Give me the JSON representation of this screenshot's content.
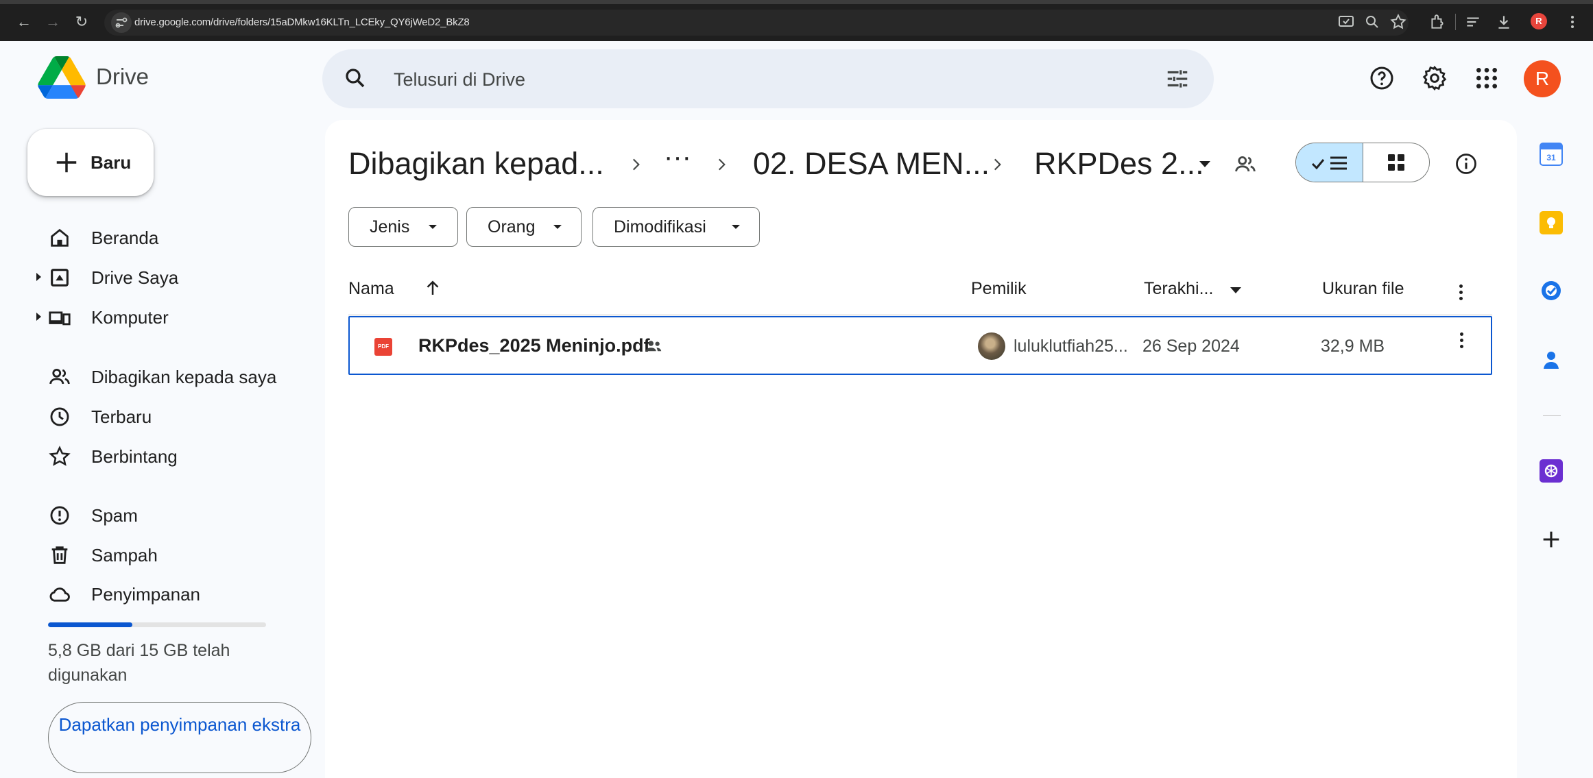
{
  "browser": {
    "url": "drive.google.com/drive/folders/15aDMkw16KLTn_LCEky_QY6jWeD2_BkZ8",
    "profile_initial": "R"
  },
  "app": {
    "product_name": "Drive",
    "account_initial": "R",
    "colors": {
      "accent": "#0b57d0",
      "selected": "#c2e7ff",
      "search_bg": "#e9eef6",
      "avatar": "#f4511e"
    }
  },
  "search": {
    "placeholder": "Telusuri di Drive"
  },
  "sidebar": {
    "new_label": "Baru",
    "items": [
      {
        "label": "Beranda",
        "icon": "home-icon"
      },
      {
        "label": "Drive Saya",
        "icon": "my-drive-icon"
      },
      {
        "label": "Komputer",
        "icon": "computer-icon"
      },
      {
        "label": "Dibagikan kepada saya",
        "icon": "people-icon"
      },
      {
        "label": "Terbaru",
        "icon": "clock-icon"
      },
      {
        "label": "Berbintang",
        "icon": "star-icon"
      },
      {
        "label": "Spam",
        "icon": "spam-icon"
      },
      {
        "label": "Sampah",
        "icon": "trash-icon"
      },
      {
        "label": "Penyimpanan",
        "icon": "cloud-icon"
      }
    ],
    "storage": {
      "text": "5,8 GB dari 15 GB telah digunakan",
      "used_fraction": 0.387
    },
    "get_storage_label": "Dapatkan penyimpanan ekstra"
  },
  "breadcrumb": {
    "root": "Dibagikan kepad...",
    "ellipsis": "···",
    "parent": "02. DESA MEN...",
    "current": "RKPDes 2..."
  },
  "filters": [
    {
      "label": "Jenis"
    },
    {
      "label": "Orang"
    },
    {
      "label": "Dimodifikasi"
    }
  ],
  "table": {
    "columns": {
      "name": "Nama",
      "owner": "Pemilik",
      "modified": "Terakhi...",
      "size": "Ukuran file"
    },
    "rows": [
      {
        "name": "RKPdes_2025 Meninjo.pdf",
        "type_badge": "PDF",
        "owner": "luluklutfiah25...",
        "modified": "26 Sep 2024",
        "size": "32,9 MB"
      }
    ]
  },
  "side_panel": {
    "apps": [
      "calendar-app-icon",
      "keep-app-icon",
      "tasks-app-icon",
      "contacts-app-icon",
      "chatgpt-addon-icon"
    ]
  }
}
